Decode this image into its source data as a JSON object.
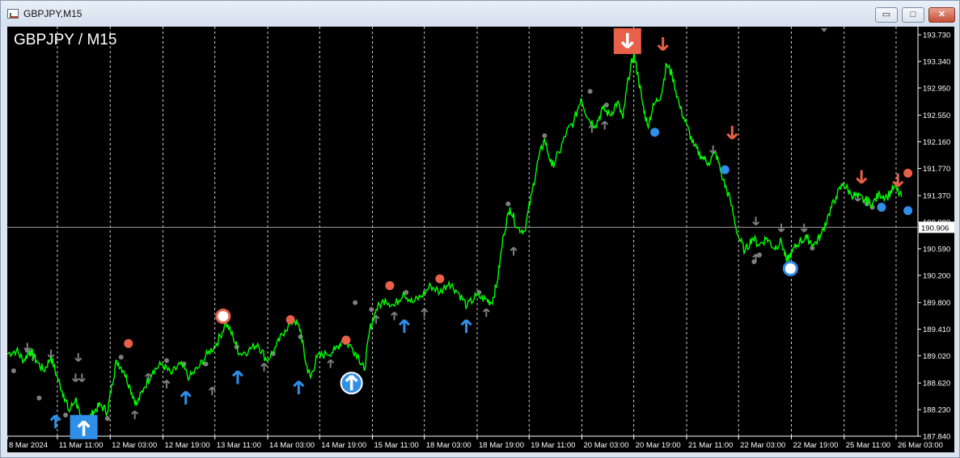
{
  "window": {
    "title": "GBPJPY,M15",
    "minimize_glyph": "▭",
    "maximize_glyph": "□",
    "close_glyph": "✕"
  },
  "chart_label": "GBPJPY / M15",
  "colors": {
    "background": "#000000",
    "price_line": "#00ff00",
    "buy_arrow": "#2f8fe8",
    "sell_arrow": "#e8604a",
    "grey_arrow": "#7f7f7f",
    "grid": "#ffffff",
    "price_marker_bg": "#ffffff"
  },
  "chart_data": {
    "type": "line",
    "symbol": "GBPJPY",
    "timeframe": "M15",
    "ylim": [
      187.84,
      193.85
    ],
    "y_ticks": [
      "193.730",
      "193.340",
      "192.950",
      "192.550",
      "192.160",
      "191.770",
      "191.370",
      "190.980",
      "190.590",
      "190.200",
      "189.800",
      "189.410",
      "189.020",
      "188.620",
      "188.230",
      "187.840"
    ],
    "current_price": "190.906",
    "x_ticks": [
      "8 Mar 2024",
      "11 Mar 11:00",
      "12 Mar 03:00",
      "12 Mar 19:00",
      "13 Mar 11:00",
      "14 Mar 03:00",
      "14 Mar 19:00",
      "15 Mar 11:00",
      "18 Mar 03:00",
      "18 Mar 19:00",
      "19 Mar 11:00",
      "20 Mar 03:00",
      "20 Mar 19:00",
      "21 Mar 11:00",
      "22 Mar 03:00",
      "22 Mar 19:00",
      "25 Mar 11:00",
      "26 Mar 03:00"
    ],
    "x_tick_fractions": [
      0.0,
      0.055,
      0.113,
      0.171,
      0.228,
      0.286,
      0.343,
      0.401,
      0.458,
      0.516,
      0.573,
      0.631,
      0.688,
      0.746,
      0.803,
      0.861,
      0.919,
      0.976
    ],
    "series": [
      {
        "points": [
          [
            0.0,
            189.05
          ],
          [
            0.01,
            189.1
          ],
          [
            0.018,
            188.95
          ],
          [
            0.025,
            189.1
          ],
          [
            0.032,
            188.95
          ],
          [
            0.04,
            188.8
          ],
          [
            0.048,
            189.0
          ],
          [
            0.055,
            188.7
          ],
          [
            0.062,
            188.45
          ],
          [
            0.068,
            188.2
          ],
          [
            0.075,
            188.4
          ],
          [
            0.08,
            188.1
          ],
          [
            0.088,
            188.05
          ],
          [
            0.095,
            188.2
          ],
          [
            0.102,
            188.3
          ],
          [
            0.11,
            188.2
          ],
          [
            0.115,
            188.6
          ],
          [
            0.12,
            188.95
          ],
          [
            0.128,
            188.8
          ],
          [
            0.135,
            188.55
          ],
          [
            0.142,
            188.3
          ],
          [
            0.15,
            188.55
          ],
          [
            0.16,
            188.8
          ],
          [
            0.17,
            188.9
          ],
          [
            0.18,
            188.75
          ],
          [
            0.19,
            188.9
          ],
          [
            0.2,
            188.7
          ],
          [
            0.21,
            188.85
          ],
          [
            0.22,
            189.05
          ],
          [
            0.23,
            189.2
          ],
          [
            0.24,
            189.5
          ],
          [
            0.248,
            189.3
          ],
          [
            0.255,
            189.05
          ],
          [
            0.265,
            189.1
          ],
          [
            0.275,
            189.2
          ],
          [
            0.285,
            188.95
          ],
          [
            0.295,
            189.15
          ],
          [
            0.305,
            189.4
          ],
          [
            0.315,
            189.55
          ],
          [
            0.322,
            189.4
          ],
          [
            0.328,
            188.9
          ],
          [
            0.333,
            188.7
          ],
          [
            0.34,
            189.0
          ],
          [
            0.35,
            189.05
          ],
          [
            0.36,
            189.1
          ],
          [
            0.368,
            189.25
          ],
          [
            0.378,
            189.15
          ],
          [
            0.386,
            189.0
          ],
          [
            0.392,
            188.8
          ],
          [
            0.398,
            189.4
          ],
          [
            0.405,
            189.7
          ],
          [
            0.415,
            189.85
          ],
          [
            0.425,
            189.75
          ],
          [
            0.435,
            189.95
          ],
          [
            0.445,
            189.8
          ],
          [
            0.455,
            189.9
          ],
          [
            0.465,
            190.05
          ],
          [
            0.475,
            189.95
          ],
          [
            0.485,
            190.1
          ],
          [
            0.495,
            189.95
          ],
          [
            0.505,
            189.75
          ],
          [
            0.515,
            189.9
          ],
          [
            0.525,
            189.85
          ],
          [
            0.532,
            189.8
          ],
          [
            0.538,
            190.1
          ],
          [
            0.545,
            190.8
          ],
          [
            0.552,
            191.2
          ],
          [
            0.56,
            190.9
          ],
          [
            0.568,
            190.85
          ],
          [
            0.576,
            191.4
          ],
          [
            0.583,
            191.9
          ],
          [
            0.59,
            192.2
          ],
          [
            0.598,
            191.8
          ],
          [
            0.606,
            192.0
          ],
          [
            0.614,
            192.3
          ],
          [
            0.622,
            192.45
          ],
          [
            0.63,
            192.8
          ],
          [
            0.638,
            192.5
          ],
          [
            0.646,
            192.4
          ],
          [
            0.654,
            192.65
          ],
          [
            0.662,
            192.55
          ],
          [
            0.67,
            192.75
          ],
          [
            0.676,
            192.5
          ],
          [
            0.682,
            193.1
          ],
          [
            0.688,
            193.45
          ],
          [
            0.693,
            193.1
          ],
          [
            0.698,
            192.7
          ],
          [
            0.703,
            192.4
          ],
          [
            0.71,
            192.7
          ],
          [
            0.718,
            192.85
          ],
          [
            0.724,
            193.3
          ],
          [
            0.73,
            193.15
          ],
          [
            0.738,
            192.7
          ],
          [
            0.746,
            192.4
          ],
          [
            0.754,
            192.1
          ],
          [
            0.762,
            191.95
          ],
          [
            0.77,
            191.85
          ],
          [
            0.778,
            192.0
          ],
          [
            0.786,
            191.6
          ],
          [
            0.794,
            191.3
          ],
          [
            0.802,
            190.8
          ],
          [
            0.81,
            190.55
          ],
          [
            0.818,
            190.75
          ],
          [
            0.826,
            190.65
          ],
          [
            0.834,
            190.75
          ],
          [
            0.842,
            190.6
          ],
          [
            0.85,
            190.7
          ],
          [
            0.856,
            190.4
          ],
          [
            0.862,
            190.55
          ],
          [
            0.87,
            190.7
          ],
          [
            0.878,
            190.75
          ],
          [
            0.886,
            190.65
          ],
          [
            0.894,
            190.8
          ],
          [
            0.902,
            191.1
          ],
          [
            0.91,
            191.35
          ],
          [
            0.918,
            191.55
          ],
          [
            0.926,
            191.4
          ],
          [
            0.934,
            191.35
          ],
          [
            0.942,
            191.3
          ],
          [
            0.95,
            191.25
          ],
          [
            0.958,
            191.4
          ],
          [
            0.966,
            191.35
          ],
          [
            0.974,
            191.5
          ],
          [
            0.982,
            191.35
          ]
        ]
      }
    ],
    "buy_arrows": [
      [
        0.053,
        188.05
      ],
      [
        0.196,
        188.4
      ],
      [
        0.253,
        188.7
      ],
      [
        0.32,
        188.55
      ],
      [
        0.436,
        189.45
      ],
      [
        0.504,
        189.45
      ]
    ],
    "buy_arrows_large": [
      [
        0.084,
        187.95
      ],
      [
        0.378,
        188.62
      ]
    ],
    "sell_arrows": [
      [
        0.72,
        193.6
      ],
      [
        0.796,
        192.3
      ],
      [
        0.938,
        191.65
      ],
      [
        0.978,
        191.6
      ]
    ],
    "sell_arrows_large": [
      [
        0.681,
        193.65
      ]
    ],
    "orange_dots": [
      [
        0.133,
        189.2
      ],
      [
        0.311,
        189.55
      ],
      [
        0.372,
        189.25
      ],
      [
        0.42,
        190.05
      ],
      [
        0.475,
        190.15
      ],
      [
        0.989,
        191.7
      ]
    ],
    "orange_rings": [
      [
        0.237,
        189.6
      ]
    ],
    "blue_dots": [
      [
        0.711,
        192.3
      ],
      [
        0.788,
        191.75
      ],
      [
        0.96,
        191.2
      ],
      [
        0.989,
        191.15
      ]
    ],
    "blue_rings": [
      [
        0.86,
        190.3
      ]
    ],
    "grey_dots": [
      [
        0.007,
        188.8
      ],
      [
        0.022,
        189.1
      ],
      [
        0.035,
        188.4
      ],
      [
        0.064,
        188.15
      ],
      [
        0.11,
        188.1
      ],
      [
        0.125,
        189.0
      ],
      [
        0.175,
        188.95
      ],
      [
        0.194,
        188.9
      ],
      [
        0.218,
        188.9
      ],
      [
        0.252,
        189.15
      ],
      [
        0.292,
        189.05
      ],
      [
        0.322,
        189.3
      ],
      [
        0.382,
        189.8
      ],
      [
        0.4,
        189.7
      ],
      [
        0.438,
        189.95
      ],
      [
        0.518,
        189.95
      ],
      [
        0.55,
        191.25
      ],
      [
        0.59,
        192.25
      ],
      [
        0.64,
        192.9
      ],
      [
        0.658,
        192.7
      ],
      [
        0.82,
        190.4
      ],
      [
        0.826,
        190.5
      ],
      [
        0.884,
        190.6
      ],
      [
        0.944,
        191.25
      ],
      [
        0.95,
        191.2
      ]
    ],
    "grey_arrows_up": [
      [
        0.028,
        189.0
      ],
      [
        0.14,
        188.15
      ],
      [
        0.155,
        188.7
      ],
      [
        0.175,
        188.6
      ],
      [
        0.225,
        188.5
      ],
      [
        0.282,
        188.85
      ],
      [
        0.355,
        188.9
      ],
      [
        0.405,
        189.55
      ],
      [
        0.425,
        189.6
      ],
      [
        0.458,
        189.65
      ],
      [
        0.526,
        189.65
      ],
      [
        0.556,
        190.55
      ],
      [
        0.642,
        192.35
      ],
      [
        0.656,
        192.4
      ],
      [
        0.822,
        190.45
      ]
    ],
    "grey_arrows_down": [
      [
        0.022,
        189.15
      ],
      [
        0.048,
        189.05
      ],
      [
        0.075,
        188.7
      ],
      [
        0.082,
        188.7
      ],
      [
        0.078,
        189.0
      ],
      [
        0.775,
        192.05
      ],
      [
        0.822,
        191.0
      ],
      [
        0.85,
        190.9
      ],
      [
        0.875,
        190.9
      ],
      [
        0.934,
        191.35
      ],
      [
        0.944,
        191.3
      ]
    ]
  }
}
